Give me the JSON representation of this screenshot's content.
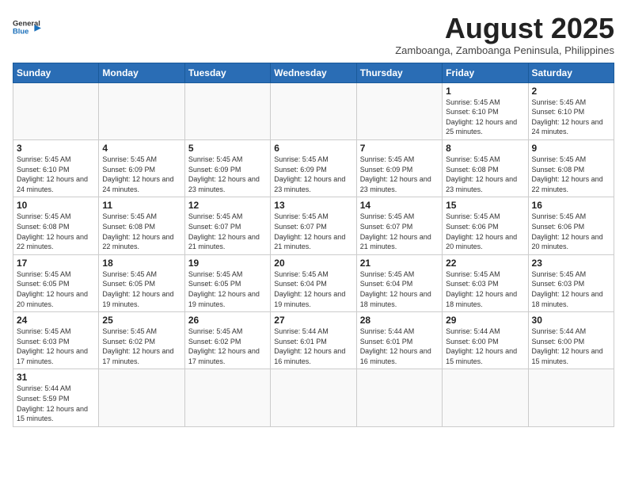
{
  "header": {
    "logo_general": "General",
    "logo_blue": "Blue",
    "month_title": "August 2025",
    "subtitle": "Zamboanga, Zamboanga Peninsula, Philippines"
  },
  "days_of_week": [
    "Sunday",
    "Monday",
    "Tuesday",
    "Wednesday",
    "Thursday",
    "Friday",
    "Saturday"
  ],
  "weeks": [
    [
      {
        "day": "",
        "info": ""
      },
      {
        "day": "",
        "info": ""
      },
      {
        "day": "",
        "info": ""
      },
      {
        "day": "",
        "info": ""
      },
      {
        "day": "",
        "info": ""
      },
      {
        "day": "1",
        "info": "Sunrise: 5:45 AM\nSunset: 6:10 PM\nDaylight: 12 hours and 25 minutes."
      },
      {
        "day": "2",
        "info": "Sunrise: 5:45 AM\nSunset: 6:10 PM\nDaylight: 12 hours and 24 minutes."
      }
    ],
    [
      {
        "day": "3",
        "info": "Sunrise: 5:45 AM\nSunset: 6:10 PM\nDaylight: 12 hours and 24 minutes."
      },
      {
        "day": "4",
        "info": "Sunrise: 5:45 AM\nSunset: 6:09 PM\nDaylight: 12 hours and 24 minutes."
      },
      {
        "day": "5",
        "info": "Sunrise: 5:45 AM\nSunset: 6:09 PM\nDaylight: 12 hours and 23 minutes."
      },
      {
        "day": "6",
        "info": "Sunrise: 5:45 AM\nSunset: 6:09 PM\nDaylight: 12 hours and 23 minutes."
      },
      {
        "day": "7",
        "info": "Sunrise: 5:45 AM\nSunset: 6:09 PM\nDaylight: 12 hours and 23 minutes."
      },
      {
        "day": "8",
        "info": "Sunrise: 5:45 AM\nSunset: 6:08 PM\nDaylight: 12 hours and 23 minutes."
      },
      {
        "day": "9",
        "info": "Sunrise: 5:45 AM\nSunset: 6:08 PM\nDaylight: 12 hours and 22 minutes."
      }
    ],
    [
      {
        "day": "10",
        "info": "Sunrise: 5:45 AM\nSunset: 6:08 PM\nDaylight: 12 hours and 22 minutes."
      },
      {
        "day": "11",
        "info": "Sunrise: 5:45 AM\nSunset: 6:08 PM\nDaylight: 12 hours and 22 minutes."
      },
      {
        "day": "12",
        "info": "Sunrise: 5:45 AM\nSunset: 6:07 PM\nDaylight: 12 hours and 21 minutes."
      },
      {
        "day": "13",
        "info": "Sunrise: 5:45 AM\nSunset: 6:07 PM\nDaylight: 12 hours and 21 minutes."
      },
      {
        "day": "14",
        "info": "Sunrise: 5:45 AM\nSunset: 6:07 PM\nDaylight: 12 hours and 21 minutes."
      },
      {
        "day": "15",
        "info": "Sunrise: 5:45 AM\nSunset: 6:06 PM\nDaylight: 12 hours and 20 minutes."
      },
      {
        "day": "16",
        "info": "Sunrise: 5:45 AM\nSunset: 6:06 PM\nDaylight: 12 hours and 20 minutes."
      }
    ],
    [
      {
        "day": "17",
        "info": "Sunrise: 5:45 AM\nSunset: 6:05 PM\nDaylight: 12 hours and 20 minutes."
      },
      {
        "day": "18",
        "info": "Sunrise: 5:45 AM\nSunset: 6:05 PM\nDaylight: 12 hours and 19 minutes."
      },
      {
        "day": "19",
        "info": "Sunrise: 5:45 AM\nSunset: 6:05 PM\nDaylight: 12 hours and 19 minutes."
      },
      {
        "day": "20",
        "info": "Sunrise: 5:45 AM\nSunset: 6:04 PM\nDaylight: 12 hours and 19 minutes."
      },
      {
        "day": "21",
        "info": "Sunrise: 5:45 AM\nSunset: 6:04 PM\nDaylight: 12 hours and 18 minutes."
      },
      {
        "day": "22",
        "info": "Sunrise: 5:45 AM\nSunset: 6:03 PM\nDaylight: 12 hours and 18 minutes."
      },
      {
        "day": "23",
        "info": "Sunrise: 5:45 AM\nSunset: 6:03 PM\nDaylight: 12 hours and 18 minutes."
      }
    ],
    [
      {
        "day": "24",
        "info": "Sunrise: 5:45 AM\nSunset: 6:03 PM\nDaylight: 12 hours and 17 minutes."
      },
      {
        "day": "25",
        "info": "Sunrise: 5:45 AM\nSunset: 6:02 PM\nDaylight: 12 hours and 17 minutes."
      },
      {
        "day": "26",
        "info": "Sunrise: 5:45 AM\nSunset: 6:02 PM\nDaylight: 12 hours and 17 minutes."
      },
      {
        "day": "27",
        "info": "Sunrise: 5:44 AM\nSunset: 6:01 PM\nDaylight: 12 hours and 16 minutes."
      },
      {
        "day": "28",
        "info": "Sunrise: 5:44 AM\nSunset: 6:01 PM\nDaylight: 12 hours and 16 minutes."
      },
      {
        "day": "29",
        "info": "Sunrise: 5:44 AM\nSunset: 6:00 PM\nDaylight: 12 hours and 15 minutes."
      },
      {
        "day": "30",
        "info": "Sunrise: 5:44 AM\nSunset: 6:00 PM\nDaylight: 12 hours and 15 minutes."
      }
    ],
    [
      {
        "day": "31",
        "info": "Sunrise: 5:44 AM\nSunset: 5:59 PM\nDaylight: 12 hours and 15 minutes."
      },
      {
        "day": "",
        "info": ""
      },
      {
        "day": "",
        "info": ""
      },
      {
        "day": "",
        "info": ""
      },
      {
        "day": "",
        "info": ""
      },
      {
        "day": "",
        "info": ""
      },
      {
        "day": "",
        "info": ""
      }
    ]
  ]
}
